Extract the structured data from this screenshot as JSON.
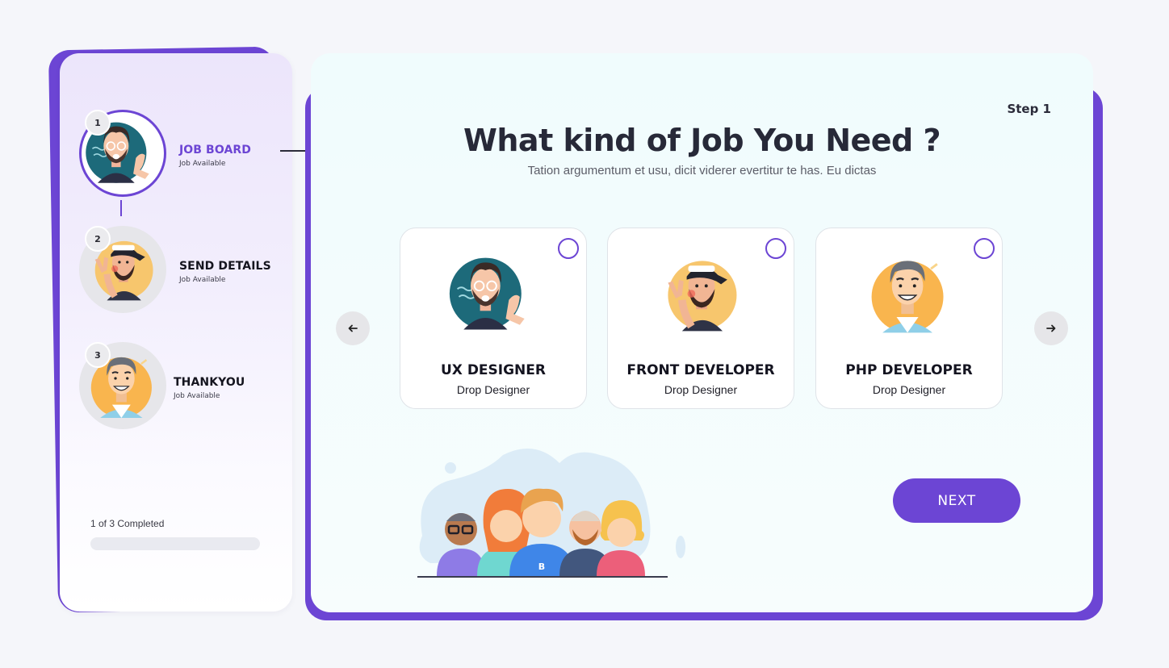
{
  "sidebar": {
    "steps": [
      {
        "number": "1",
        "title": "JOB BOARD",
        "subtitle": "Job Available",
        "active": true
      },
      {
        "number": "2",
        "title": "SEND DETAILS",
        "subtitle": "Job Available",
        "active": false
      },
      {
        "number": "3",
        "title": "THANKYOU",
        "subtitle": "Job Available",
        "active": false
      }
    ],
    "progress": {
      "label": "1 of 3 Completed",
      "fraction": 0
    }
  },
  "main": {
    "step_label": "Step 1",
    "title": "What kind of Job You Need ?",
    "subtitle": "Tation argumentum et usu, dicit viderer evertitur te has. Eu dictas",
    "nav": {
      "prev_icon": "arrow-left-icon",
      "next_icon": "arrow-right-icon"
    },
    "jobs": [
      {
        "title": "UX DESIGNER",
        "subtitle": "Drop Designer",
        "selected": false
      },
      {
        "title": "FRONT DEVELOPER",
        "subtitle": "Drop Designer",
        "selected": false
      },
      {
        "title": "PHP DEVELOPER",
        "subtitle": "Drop Designer",
        "selected": false
      }
    ],
    "next_label": "NEXT"
  },
  "colors": {
    "accent": "#6c45d4",
    "teal_avatar": "#1e6b7b",
    "orange_avatar": "#fbb551",
    "yellow_avatar": "#f7c56a"
  }
}
